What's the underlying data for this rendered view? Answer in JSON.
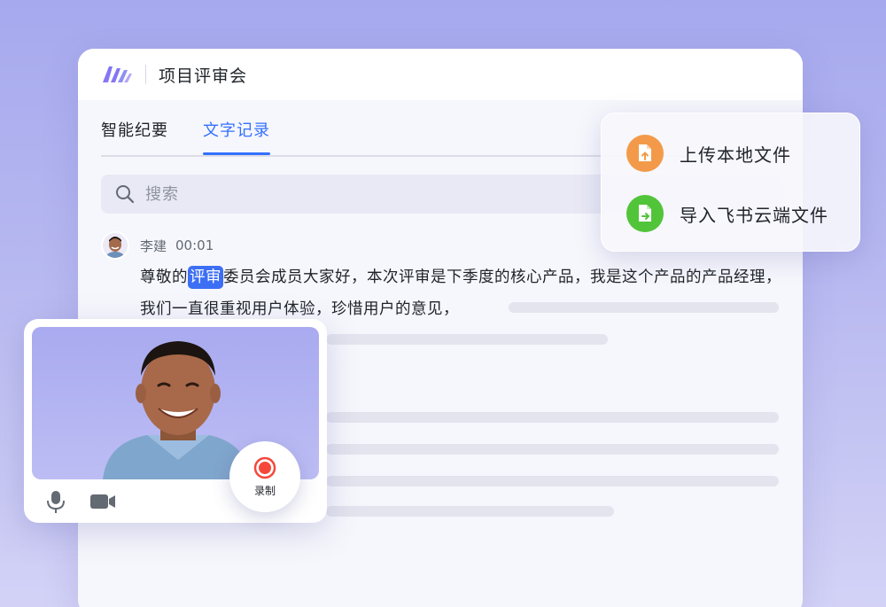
{
  "window": {
    "title": "项目评审会"
  },
  "tabs": [
    {
      "label": "智能纪要",
      "active": false
    },
    {
      "label": "文字记录",
      "active": true
    }
  ],
  "search": {
    "placeholder": "搜索"
  },
  "speaker": {
    "name": "李建",
    "time": "00:01"
  },
  "transcript": {
    "before": "尊敬的",
    "highlight": "评审",
    "after": "委员会成员大家好，本次评审是下季度的核心产品，我是这个产品的产品经理，我们一直很重视用户体验，珍惜用户的意见，"
  },
  "popup": {
    "items": [
      {
        "label": "上传本地文件",
        "icon": "upload-file-icon",
        "color": "#f39a4a"
      },
      {
        "label": "导入飞书云端文件",
        "icon": "import-cloud-file-icon",
        "color": "#52c43a"
      }
    ]
  },
  "video": {
    "record_label": "录制",
    "controls": [
      "microphone-icon",
      "camera-icon"
    ],
    "record_color": "#f5483b"
  },
  "colors": {
    "accent": "#3370ff",
    "highlight": "#3d6ff5"
  }
}
